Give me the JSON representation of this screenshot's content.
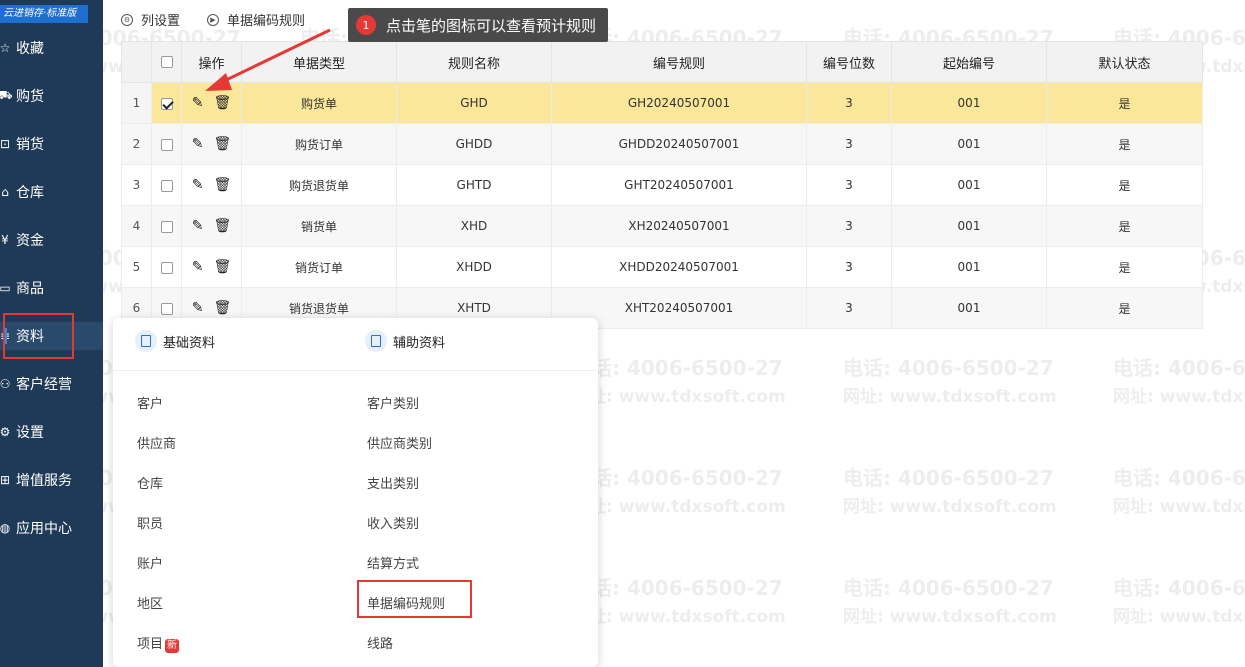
{
  "brand": "云进销存·标准版",
  "sidebar": {
    "items": [
      {
        "icon": "star-icon",
        "glyph": "☆",
        "label": "收藏"
      },
      {
        "icon": "cart-icon",
        "glyph": "⛟",
        "label": "购货"
      },
      {
        "icon": "sales-icon",
        "glyph": "⊡",
        "label": "销货"
      },
      {
        "icon": "warehouse-icon",
        "glyph": "⌂",
        "label": "仓库"
      },
      {
        "icon": "yen-icon",
        "glyph": "¥",
        "label": "资金"
      },
      {
        "icon": "goods-icon",
        "glyph": "▭",
        "label": "商品"
      },
      {
        "icon": "data-icon",
        "glyph": "≡",
        "label": "资料"
      },
      {
        "icon": "customer-icon",
        "glyph": "⚇",
        "label": "客户经营"
      },
      {
        "icon": "settings-icon",
        "glyph": "⚙",
        "label": "设置"
      },
      {
        "icon": "value-added-icon",
        "glyph": "⊞",
        "label": "增值服务"
      },
      {
        "icon": "app-center-icon",
        "glyph": "◍",
        "label": "应用中心"
      }
    ]
  },
  "toolbar": {
    "column_settings": "列设置",
    "code_rules": "单据编码规则"
  },
  "tooltip": {
    "number": "1",
    "text": "点击笔的图标可以查看预计规则"
  },
  "table": {
    "headers": [
      "",
      "",
      "操作",
      "单据类型",
      "规则名称",
      "编号规则",
      "编号位数",
      "起始编号",
      "默认状态"
    ],
    "rows": [
      {
        "no": "1",
        "type": "购货单",
        "name": "GHD",
        "rule": "GH20240507001",
        "digits": "3",
        "start": "001",
        "default": "是"
      },
      {
        "no": "2",
        "type": "购货订单",
        "name": "GHDD",
        "rule": "GHDD20240507001",
        "digits": "3",
        "start": "001",
        "default": "是"
      },
      {
        "no": "3",
        "type": "购货退货单",
        "name": "GHTD",
        "rule": "GHT20240507001",
        "digits": "3",
        "start": "001",
        "default": "是"
      },
      {
        "no": "4",
        "type": "销货单",
        "name": "XHD",
        "rule": "XH20240507001",
        "digits": "3",
        "start": "001",
        "default": "是"
      },
      {
        "no": "5",
        "type": "销货订单",
        "name": "XHDD",
        "rule": "XHDD20240507001",
        "digits": "3",
        "start": "001",
        "default": "是"
      },
      {
        "no": "6",
        "type": "销货退货单",
        "name": "XHTD",
        "rule": "XHT20240507001",
        "digits": "3",
        "start": "001",
        "default": "是"
      }
    ]
  },
  "panel": {
    "basic_title": "基础资料",
    "aux_title": "辅助资料",
    "basic_items": [
      "客户",
      "供应商",
      "仓库",
      "职员",
      "账户",
      "地区",
      "项目"
    ],
    "aux_items": [
      "客户类别",
      "供应商类别",
      "支出类别",
      "收入类别",
      "结算方式",
      "单据编码规则",
      "线路"
    ],
    "new_badge": "新"
  },
  "watermark": {
    "phone": "电话: 4006-6500-27",
    "site": "网址: www.tdxsoft.com"
  },
  "colors": {
    "sidebar": "#1f3a56",
    "selected_row": "#fbe79a",
    "highlight": "#e53935"
  }
}
